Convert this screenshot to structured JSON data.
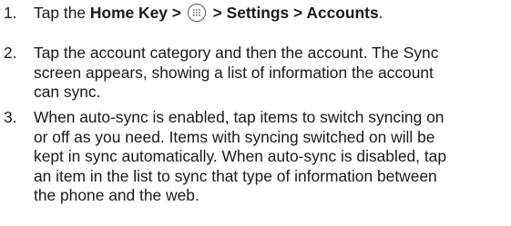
{
  "steps": [
    {
      "number": "1.",
      "prefix": "Tap the ",
      "home_key": "Home Key >",
      "apps_icon": "apps-grid-icon",
      "path": "> Settings > Accounts",
      "suffix": "."
    },
    {
      "number": "2.",
      "lines": [
        "Tap the account category and then the account. The Sync",
        "screen appears, showing a list of information the account",
        "can sync."
      ]
    },
    {
      "number": "3.",
      "lines": [
        "When auto-sync is enabled, tap items to switch syncing on",
        "or off as you need. Items with syncing switched on will be",
        "kept in sync automatically. When auto-sync is disabled, tap",
        "an item in the list to sync that type of information between",
        "the phone and the web."
      ]
    }
  ]
}
